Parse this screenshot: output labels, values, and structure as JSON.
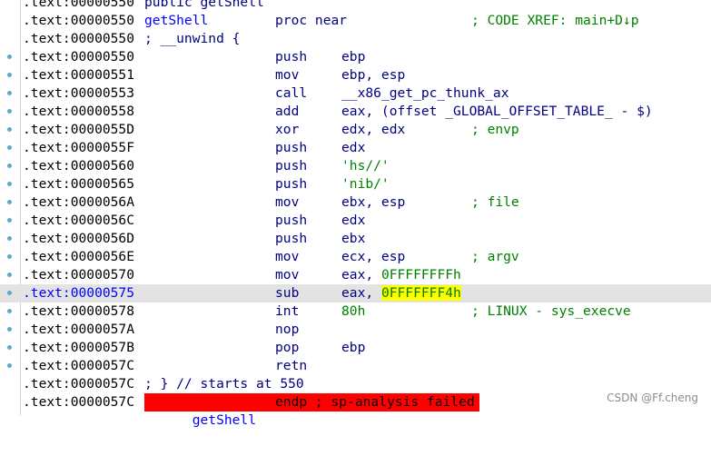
{
  "colors": {
    "background": "#ffffff",
    "address_text": "#000000",
    "selected_address_text": "#0000ff",
    "code_text": "#000080",
    "comment_text": "#008000",
    "selected_row_background": "#e3e3e3",
    "highlight_background": "#ffff00",
    "error_background": "#ff0000",
    "breakpoint_dot": "#5fa8c8"
  },
  "listing": {
    "rows": {
      "r0": {
        "addr": ".text:00000550",
        "directive": "public getShell"
      },
      "r1": {
        "addr": ".text:00000550",
        "label": "getShell",
        "mnem": "proc near",
        "comment": "; CODE XREF: main+D↓p"
      },
      "r2": {
        "addr": ".text:00000550",
        "directive": "; __unwind {"
      },
      "r3": {
        "addr": ".text:00000550",
        "mnem": "push",
        "ops": "ebp"
      },
      "r4": {
        "addr": ".text:00000551",
        "mnem": "mov",
        "ops": "ebp, esp"
      },
      "r5": {
        "addr": ".text:00000553",
        "mnem": "call",
        "ops": "__x86_get_pc_thunk_ax"
      },
      "r6": {
        "addr": ".text:00000558",
        "mnem": "add",
        "ops": "eax, (offset _GLOBAL_OFFSET_TABLE_ - $)"
      },
      "r7": {
        "addr": ".text:0000055D",
        "mnem": "xor",
        "ops": "edx, edx",
        "comment": "; envp"
      },
      "r8": {
        "addr": ".text:0000055F",
        "mnem": "push",
        "ops": "edx"
      },
      "r9": {
        "addr": ".text:00000560",
        "mnem": "push",
        "ops": "'hs//'"
      },
      "r10": {
        "addr": ".text:00000565",
        "mnem": "push",
        "ops": "'nib/'"
      },
      "r11": {
        "addr": ".text:0000056A",
        "mnem": "mov",
        "ops": "ebx, esp",
        "comment": "; file"
      },
      "r12": {
        "addr": ".text:0000056C",
        "mnem": "push",
        "ops": "edx"
      },
      "r13": {
        "addr": ".text:0000056D",
        "mnem": "push",
        "ops": "ebx"
      },
      "r14": {
        "addr": ".text:0000056E",
        "mnem": "mov",
        "ops": "ecx, esp",
        "comment": "; argv"
      },
      "r15": {
        "addr": ".text:00000570",
        "mnem": "mov",
        "ops_reg": "eax, ",
        "ops_num": "0FFFFFFFFh"
      },
      "r16": {
        "addr": ".text:00000575",
        "mnem": "sub",
        "ops_reg": "eax, ",
        "ops_num": "0FFFFFFF4h"
      },
      "r17": {
        "addr": ".text:00000578",
        "mnem": "int",
        "ops_num": "80h",
        "comment": "; LINUX - sys_execve"
      },
      "r18": {
        "addr": ".text:0000057A",
        "mnem": "nop"
      },
      "r19": {
        "addr": ".text:0000057B",
        "mnem": "pop",
        "ops": "ebp"
      },
      "r20": {
        "addr": ".text:0000057C",
        "mnem": "retn"
      },
      "r21": {
        "addr": ".text:0000057C",
        "directive": "; } // starts at 550"
      },
      "r22": {
        "addr": ".text:0000057C",
        "label": "getShell",
        "mnem": "endp ; sp-analysis failed"
      }
    }
  },
  "watermark": "CSDN @Ff.cheng"
}
